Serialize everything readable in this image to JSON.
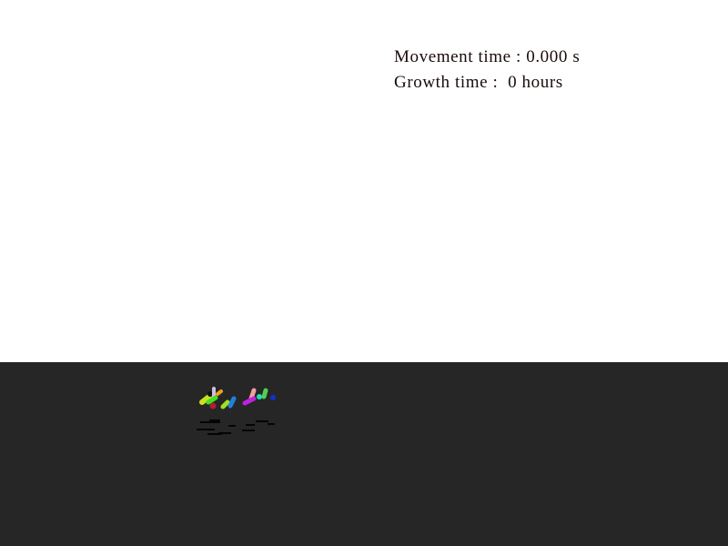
{
  "hud": {
    "movement_label": "Movement time : ",
    "movement_value": "0.000 s",
    "growth_label": "Growth time :  ",
    "growth_value": "0 hours"
  },
  "scene": {
    "background_color": "#ffffff",
    "floor_color": "#2e2e2e",
    "cell_colors": [
      "#c8e020",
      "#111111",
      "#c8c0e8",
      "#f0a020",
      "#40e020",
      "#b02030",
      "#a0e020",
      "#2080e0",
      "#f0a0a0",
      "#c020e0",
      "#20e0b0",
      "#50d050",
      "#1030d0"
    ]
  }
}
